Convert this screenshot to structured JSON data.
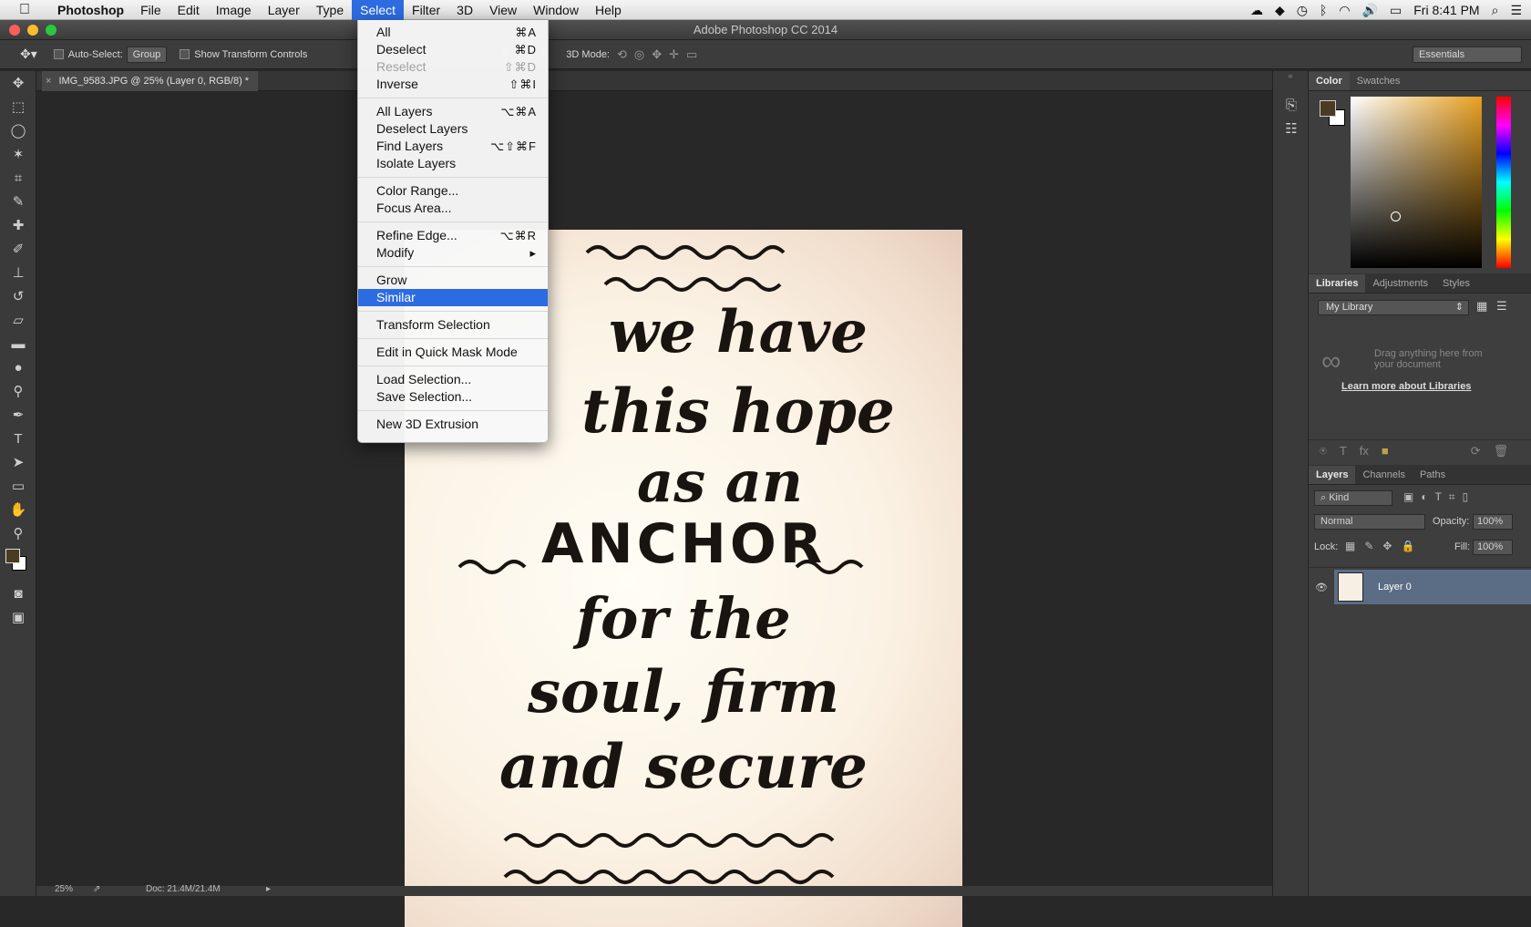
{
  "menubar": {
    "app": "Photoshop",
    "items": [
      "File",
      "Edit",
      "Image",
      "Layer",
      "Type",
      "Select",
      "Filter",
      "3D",
      "View",
      "Window",
      "Help"
    ],
    "active_index": 5,
    "clock": "Fri 8:41 PM"
  },
  "window_title": "Adobe Photoshop CC 2014",
  "options": {
    "auto_select": "Auto-Select:",
    "group": "Group",
    "show_transform": "Show Transform Controls",
    "mode_3d": "3D Mode:",
    "workspace": "Essentials"
  },
  "document": {
    "tab_title": "IMG_9583.JPG @ 25% (Layer 0, RGB/8) *",
    "lines": [
      "we have",
      "this hope",
      "as an",
      "ANCHOR",
      "for the",
      "soul, firm",
      "and secure"
    ]
  },
  "status": {
    "zoom": "25%",
    "doc": "Doc: 21.4M/21.4M"
  },
  "select_menu": [
    {
      "label": "All",
      "shortcut": "⌘A"
    },
    {
      "label": "Deselect",
      "shortcut": "⌘D"
    },
    {
      "label": "Reselect",
      "shortcut": "⇧⌘D",
      "disabled": true
    },
    {
      "label": "Inverse",
      "shortcut": "⇧⌘I"
    },
    {
      "sep": true
    },
    {
      "label": "All Layers",
      "shortcut": "⌥⌘A"
    },
    {
      "label": "Deselect Layers",
      "shortcut": ""
    },
    {
      "label": "Find Layers",
      "shortcut": "⌥⇧⌘F"
    },
    {
      "label": "Isolate Layers",
      "shortcut": ""
    },
    {
      "sep": true
    },
    {
      "label": "Color Range...",
      "shortcut": ""
    },
    {
      "label": "Focus Area...",
      "shortcut": ""
    },
    {
      "sep": true
    },
    {
      "label": "Refine Edge...",
      "shortcut": "⌥⌘R"
    },
    {
      "label": "Modify",
      "shortcut": "▸"
    },
    {
      "sep": true
    },
    {
      "label": "Grow",
      "shortcut": ""
    },
    {
      "label": "Similar",
      "shortcut": "",
      "highlighted": true
    },
    {
      "sep": true
    },
    {
      "label": "Transform Selection",
      "shortcut": ""
    },
    {
      "sep": true
    },
    {
      "label": "Edit in Quick Mask Mode",
      "shortcut": ""
    },
    {
      "sep": true
    },
    {
      "label": "Load Selection...",
      "shortcut": ""
    },
    {
      "label": "Save Selection...",
      "shortcut": ""
    },
    {
      "sep": true
    },
    {
      "label": "New 3D Extrusion",
      "shortcut": ""
    }
  ],
  "color_panel": {
    "tabs": [
      "Color",
      "Swatches"
    ],
    "hue_color": "#e8a020"
  },
  "libraries_panel": {
    "tabs": [
      "Libraries",
      "Adjustments",
      "Styles"
    ],
    "library": "My Library",
    "hint": "Drag anything here from your document",
    "link": "Learn more about Libraries"
  },
  "layers_panel": {
    "tabs": [
      "Layers",
      "Channels",
      "Paths"
    ],
    "kind": "Kind",
    "blend": "Normal",
    "opacity_label": "Opacity:",
    "opacity": "100%",
    "lock_label": "Lock:",
    "fill_label": "Fill:",
    "fill": "100%",
    "layer_name": "Layer 0"
  }
}
